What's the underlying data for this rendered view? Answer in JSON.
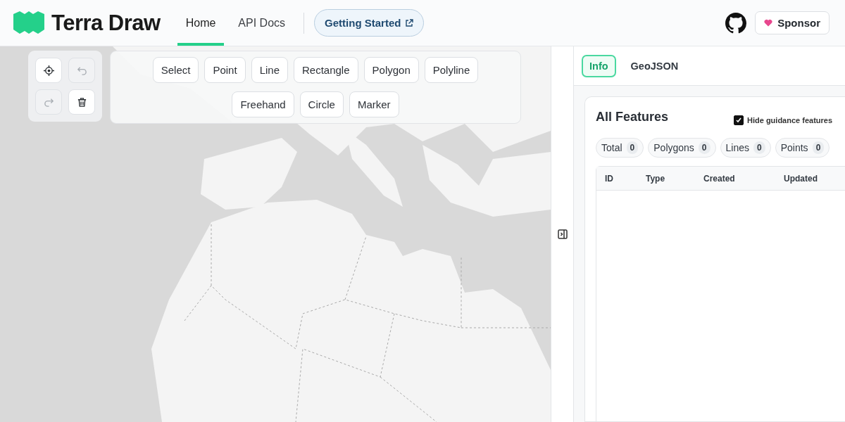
{
  "header": {
    "logo": "Terra Draw",
    "nav": [
      {
        "label": "Home",
        "selected": true
      },
      {
        "label": "API Docs",
        "selected": false
      }
    ],
    "getting_started": "Getting Started",
    "sponsor": "Sponsor"
  },
  "map_controls": [
    {
      "kind": "locate",
      "disabled": false
    },
    {
      "kind": "undo",
      "disabled": true
    },
    {
      "kind": "redo",
      "disabled": true
    },
    {
      "kind": "delete",
      "disabled": false
    }
  ],
  "modes": [
    {
      "label": "Select",
      "selected": false
    },
    {
      "label": "Point",
      "selected": false
    },
    {
      "label": "Line",
      "selected": false
    },
    {
      "label": "Rectangle",
      "selected": false
    },
    {
      "label": "Polygon",
      "selected": false
    },
    {
      "label": "Polyline",
      "selected": false
    },
    {
      "label": "Freehand",
      "selected": false
    },
    {
      "label": "Circle",
      "selected": false
    },
    {
      "label": "Marker",
      "selected": false
    }
  ],
  "panel": {
    "tabs": [
      {
        "label": "Info",
        "selected": true
      },
      {
        "label": "GeoJSON",
        "selected": false
      }
    ],
    "title": "All Features",
    "hide_guidance": {
      "label": "Hide guidance features",
      "checked": true
    },
    "counts": [
      {
        "label": "Total",
        "value": "0"
      },
      {
        "label": "Polygons",
        "value": "0"
      },
      {
        "label": "Lines",
        "value": "0"
      },
      {
        "label": "Points",
        "value": "0"
      }
    ],
    "columns": [
      "ID",
      "Type",
      "Created",
      "Updated"
    ]
  }
}
